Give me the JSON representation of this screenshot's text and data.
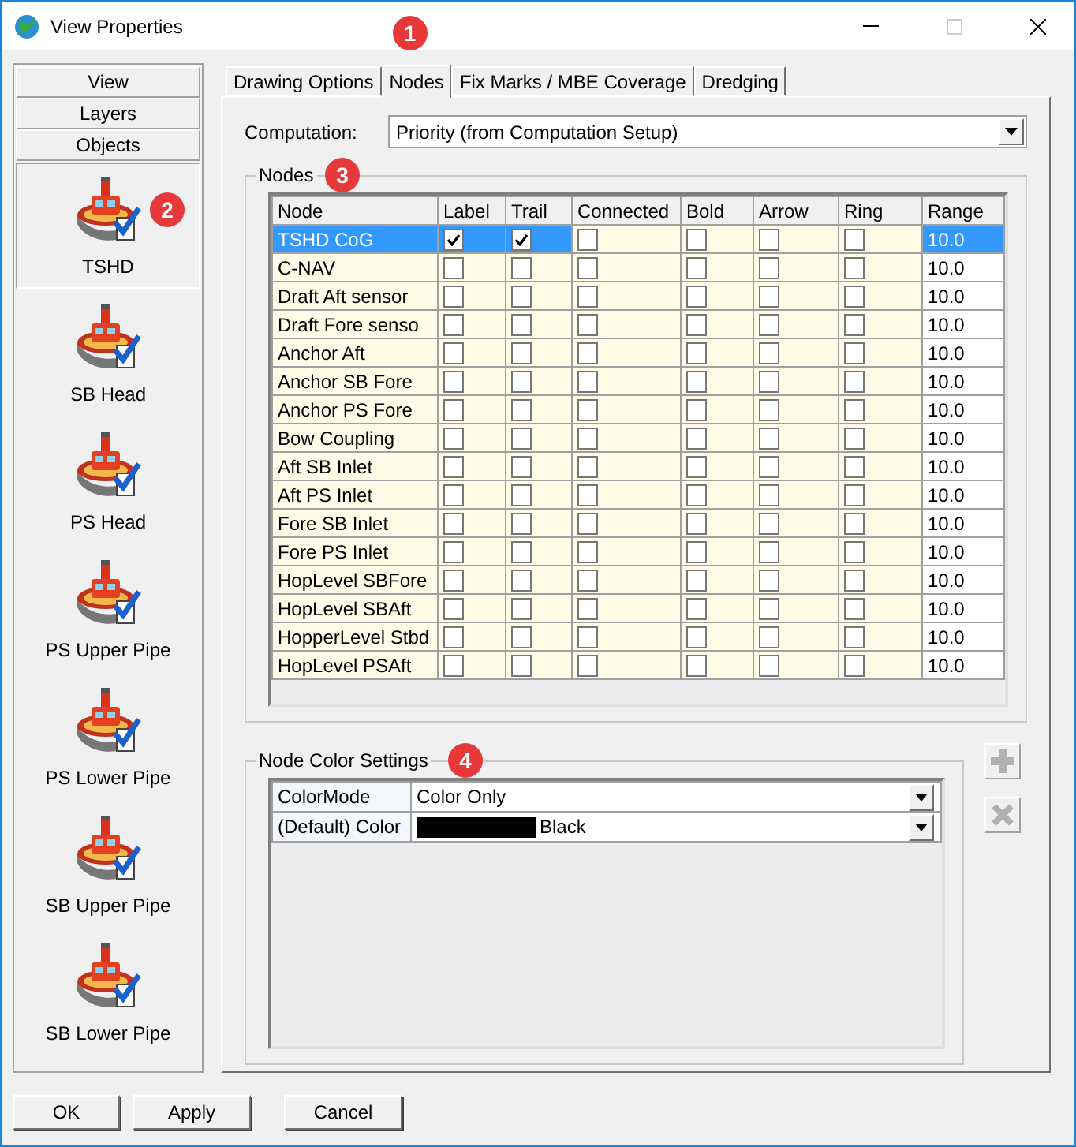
{
  "window": {
    "title": "View Properties"
  },
  "sidebar": {
    "sections": [
      "View",
      "Layers",
      "Objects"
    ],
    "objects": [
      {
        "label": "TSHD",
        "selected": true,
        "callout": "2"
      },
      {
        "label": "SB Head",
        "selected": false
      },
      {
        "label": "PS Head",
        "selected": false
      },
      {
        "label": "PS Upper Pipe",
        "selected": false
      },
      {
        "label": "PS Lower Pipe",
        "selected": false
      },
      {
        "label": "SB Upper Pipe",
        "selected": false
      },
      {
        "label": "SB Lower Pipe",
        "selected": false
      }
    ]
  },
  "tabs": [
    {
      "label": "Drawing Options",
      "selected": false
    },
    {
      "label": "Nodes",
      "selected": true,
      "callout": "1"
    },
    {
      "label": "Fix Marks / MBE Coverage",
      "selected": false
    },
    {
      "label": "Dredging",
      "selected": false
    }
  ],
  "computation": {
    "label": "Computation:",
    "value": "Priority (from Computation Setup)"
  },
  "nodes_group": {
    "title": "Nodes",
    "callout": "3",
    "columns": [
      "Node",
      "Label",
      "Trail",
      "Connected",
      "Bold",
      "Arrow",
      "Ring",
      "Range"
    ],
    "rows": [
      {
        "name": "TSHD CoG",
        "selected": true,
        "checks": [
          true,
          true,
          false,
          false,
          false,
          false
        ],
        "range": "10.0"
      },
      {
        "name": "C-NAV",
        "selected": false,
        "checks": [
          false,
          false,
          false,
          false,
          false,
          false
        ],
        "range": "10.0"
      },
      {
        "name": "Draft Aft sensor",
        "selected": false,
        "checks": [
          false,
          false,
          false,
          false,
          false,
          false
        ],
        "range": "10.0"
      },
      {
        "name": "Draft Fore senso",
        "selected": false,
        "checks": [
          false,
          false,
          false,
          false,
          false,
          false
        ],
        "range": "10.0"
      },
      {
        "name": "Anchor Aft",
        "selected": false,
        "checks": [
          false,
          false,
          false,
          false,
          false,
          false
        ],
        "range": "10.0"
      },
      {
        "name": "Anchor SB Fore",
        "selected": false,
        "checks": [
          false,
          false,
          false,
          false,
          false,
          false
        ],
        "range": "10.0"
      },
      {
        "name": "Anchor PS Fore",
        "selected": false,
        "checks": [
          false,
          false,
          false,
          false,
          false,
          false
        ],
        "range": "10.0"
      },
      {
        "name": "Bow Coupling",
        "selected": false,
        "checks": [
          false,
          false,
          false,
          false,
          false,
          false
        ],
        "range": "10.0"
      },
      {
        "name": "Aft SB Inlet",
        "selected": false,
        "checks": [
          false,
          false,
          false,
          false,
          false,
          false
        ],
        "range": "10.0"
      },
      {
        "name": "Aft PS Inlet",
        "selected": false,
        "checks": [
          false,
          false,
          false,
          false,
          false,
          false
        ],
        "range": "10.0"
      },
      {
        "name": "Fore SB Inlet",
        "selected": false,
        "checks": [
          false,
          false,
          false,
          false,
          false,
          false
        ],
        "range": "10.0"
      },
      {
        "name": "Fore PS Inlet",
        "selected": false,
        "checks": [
          false,
          false,
          false,
          false,
          false,
          false
        ],
        "range": "10.0"
      },
      {
        "name": "HopLevel SBFore",
        "selected": false,
        "checks": [
          false,
          false,
          false,
          false,
          false,
          false
        ],
        "range": "10.0"
      },
      {
        "name": "HopLevel SBAft",
        "selected": false,
        "checks": [
          false,
          false,
          false,
          false,
          false,
          false
        ],
        "range": "10.0"
      },
      {
        "name": "HopperLevel Stbd",
        "selected": false,
        "checks": [
          false,
          false,
          false,
          false,
          false,
          false
        ],
        "range": "10.0"
      },
      {
        "name": "HopLevel PSAft",
        "selected": false,
        "checks": [
          false,
          false,
          false,
          false,
          false,
          false
        ],
        "range": "10.0"
      }
    ]
  },
  "color_group": {
    "title": "Node Color Settings",
    "callout": "4",
    "rows": [
      {
        "name": "ColorMode",
        "value": "Color Only"
      },
      {
        "name": "(Default) Color",
        "value": "Black",
        "color": "#000000"
      }
    ]
  },
  "buttons": [
    "OK",
    "Apply",
    "Cancel"
  ]
}
